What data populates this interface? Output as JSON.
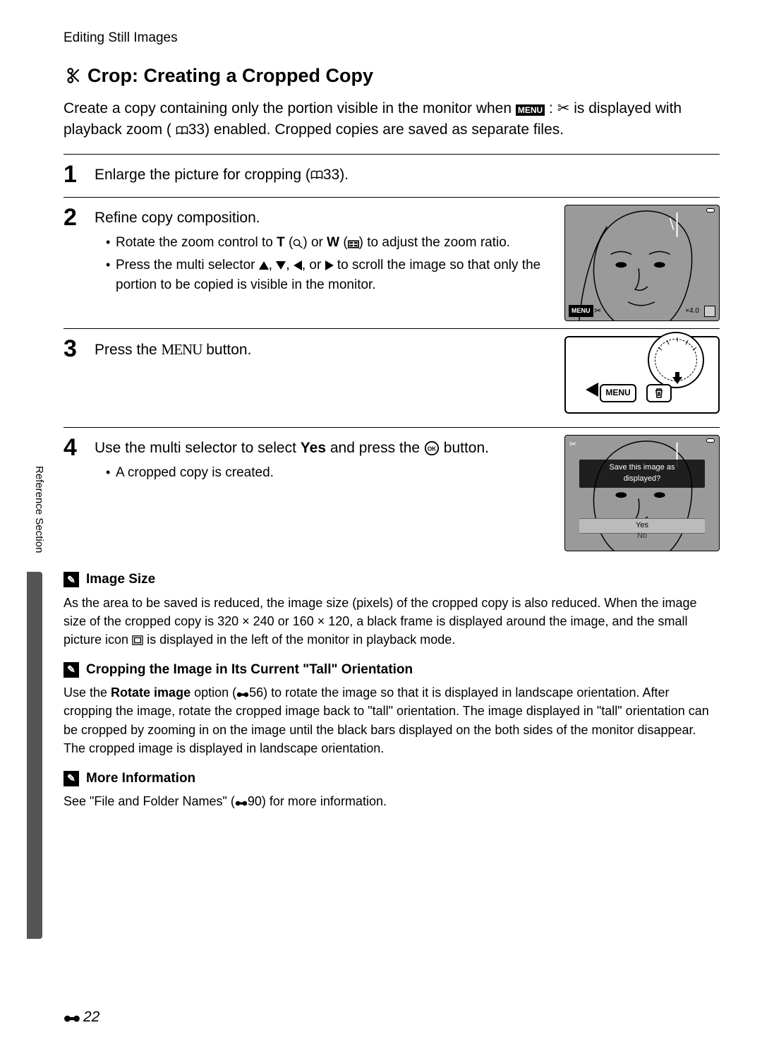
{
  "header": "Editing Still Images",
  "title": "Crop: Creating a Cropped Copy",
  "intro_pre": "Create a copy containing only the portion visible in the monitor when ",
  "intro_menu": "MENU",
  "intro_mid": " is displayed with playback zoom (",
  "intro_ref": "33) enabled. Cropped copies are saved as separate files.",
  "steps": [
    {
      "num": "1",
      "title_pre": "Enlarge the picture for cropping (",
      "title_ref": "33)."
    },
    {
      "num": "2",
      "title": "Refine copy composition.",
      "bullets": [
        "Rotate the zoom control to T or W to adjust the zoom ratio.",
        "Press the multi selector ▲, ▼, ◀, or ▶ to scroll the image so that only the portion to be copied is visible in the monitor."
      ],
      "screen": {
        "menu": "MENU",
        "zoom": "×4.0"
      }
    },
    {
      "num": "3",
      "title_pre": "Press the ",
      "title_btn": "MENU",
      "title_post": " button.",
      "camera": {
        "menu": "MENU"
      }
    },
    {
      "num": "4",
      "title_pre": "Use the multi selector to select ",
      "title_bold": "Yes",
      "title_mid": " and press the ",
      "title_post": " button.",
      "bullet": "A cropped copy is created.",
      "dialog": {
        "msg1": "Save this image as",
        "msg2": "displayed?",
        "yes": "Yes",
        "no": "No"
      }
    }
  ],
  "notes": [
    {
      "title": "Image Size",
      "body": "As the area to be saved is reduced, the image size (pixels) of the cropped copy is also reduced. When the image size of the cropped copy is 320 × 240 or 160 × 120, a black frame is displayed around the image, and the small picture icon is displayed in the left of the monitor in playback mode."
    },
    {
      "title": "Cropping the Image in Its Current \"Tall\" Orientation",
      "body_pre": "Use the ",
      "body_bold": "Rotate image",
      "body_post": " option (🔗56) to rotate the image so that it is displayed in landscape orientation. After cropping the image, rotate the cropped image back to \"tall\" orientation. The image displayed in \"tall\" orientation can be cropped by zooming in on the image until the black bars displayed on the both sides of the monitor disappear. The cropped image is displayed in landscape orientation."
    },
    {
      "title": "More Information",
      "body": "See \"File and Folder Names\" (🔗90) for more information."
    }
  ],
  "side_label": "Reference Section",
  "page_number": "22"
}
